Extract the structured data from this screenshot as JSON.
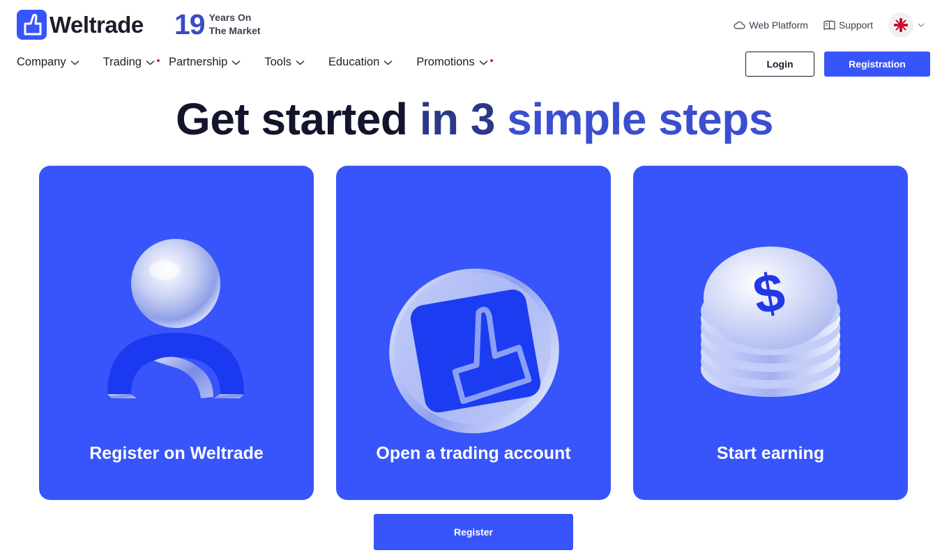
{
  "header": {
    "brand": "Weltrade",
    "years_number": "19",
    "years_text_line1": "Years On",
    "years_text_line2": "The Market",
    "web_platform_label": "Web Platform",
    "support_label": "Support",
    "language_icon": "uk-flag-icon"
  },
  "nav": {
    "items": [
      {
        "label": "Company",
        "has_dot": false
      },
      {
        "label": "Trading",
        "has_dot": true
      },
      {
        "label": "Partnership",
        "has_dot": false
      },
      {
        "label": "Tools",
        "has_dot": false
      },
      {
        "label": "Education",
        "has_dot": false
      },
      {
        "label": "Promotions",
        "has_dot": true
      }
    ],
    "login_label": "Login",
    "registration_label": "Registration"
  },
  "hero": {
    "headline_part1": "Get started",
    "headline_part2": " in 3 ",
    "headline_part3": "simple steps"
  },
  "steps": [
    {
      "title": "Register on Weltrade",
      "icon": "user-3d-icon"
    },
    {
      "title": "Open a trading account",
      "icon": "weltrade-coin-icon"
    },
    {
      "title": "Start earning",
      "icon": "coin-stack-icon"
    }
  ],
  "cta": {
    "register_label": "Register"
  },
  "colors": {
    "brand_blue": "#3755fa",
    "dot_red": "#e1221b",
    "text_dark": "#1b1d2c"
  }
}
